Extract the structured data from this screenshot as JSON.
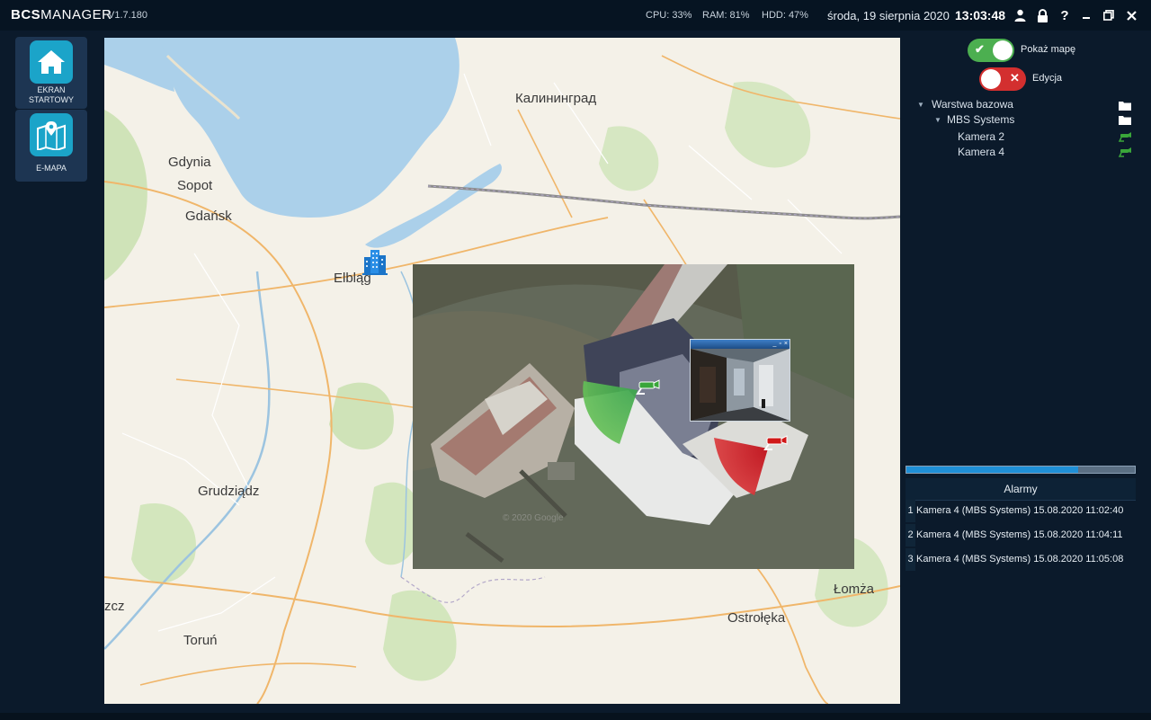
{
  "app": {
    "logo_bcs": "BCS",
    "logo_manager": "MANAGER",
    "version": "V1.7.180"
  },
  "status": {
    "cpu": "CPU:  33%",
    "ram": "RAM:  81%",
    "hdd": "HDD:  47%",
    "date": "środa, 19 sierpnia 2020",
    "time": "13:03:48"
  },
  "titlebar_icons": [
    "user-icon",
    "lock-icon",
    "help-icon",
    "minimize-icon",
    "restore-icon",
    "close-icon"
  ],
  "nav": {
    "home_label_1": "EKRAN",
    "home_label_2": "STARTOWY",
    "emap_label": "E-MAPA"
  },
  "map": {
    "cities": {
      "kaliningrad": "Калининград",
      "gdynia": "Gdynia",
      "sopot": "Sopot",
      "gdansk": "Gdańsk",
      "elblag": "Elbląg",
      "grudziadz": "Grudziądz",
      "torun": "Toruń",
      "ostroleka": "Ostrołęka",
      "lomza": "Łomża",
      "zcz": "zcz"
    },
    "satellite_watermark": "© 2020 Google"
  },
  "right_panel": {
    "show_map_label": "Pokaż mapę",
    "show_map_on": true,
    "edit_label": "Edycja",
    "edit_on": false,
    "tree": {
      "root": "Warstwa bazowa",
      "group": "MBS Systems",
      "cameras": [
        "Kamera 2",
        "Kamera 4"
      ]
    },
    "progress": 0.75,
    "alarms_title": "Alarmy",
    "alarms": [
      {
        "num": "1",
        "text": "Kamera 4 (MBS Systems) 15.08.2020 11:02:40"
      },
      {
        "num": "2",
        "text": "Kamera 4 (MBS Systems) 15.08.2020 11:04:11"
      },
      {
        "num": "3",
        "text": "Kamera 4 (MBS Systems) 15.08.2020 11:05:08"
      }
    ]
  },
  "colors": {
    "accent": "#1ba4c9",
    "toggle_on": "#4caf50",
    "toggle_off": "#d32f2f",
    "camera_ok": "#3aa63a",
    "camera_alarm": "#d01818"
  }
}
